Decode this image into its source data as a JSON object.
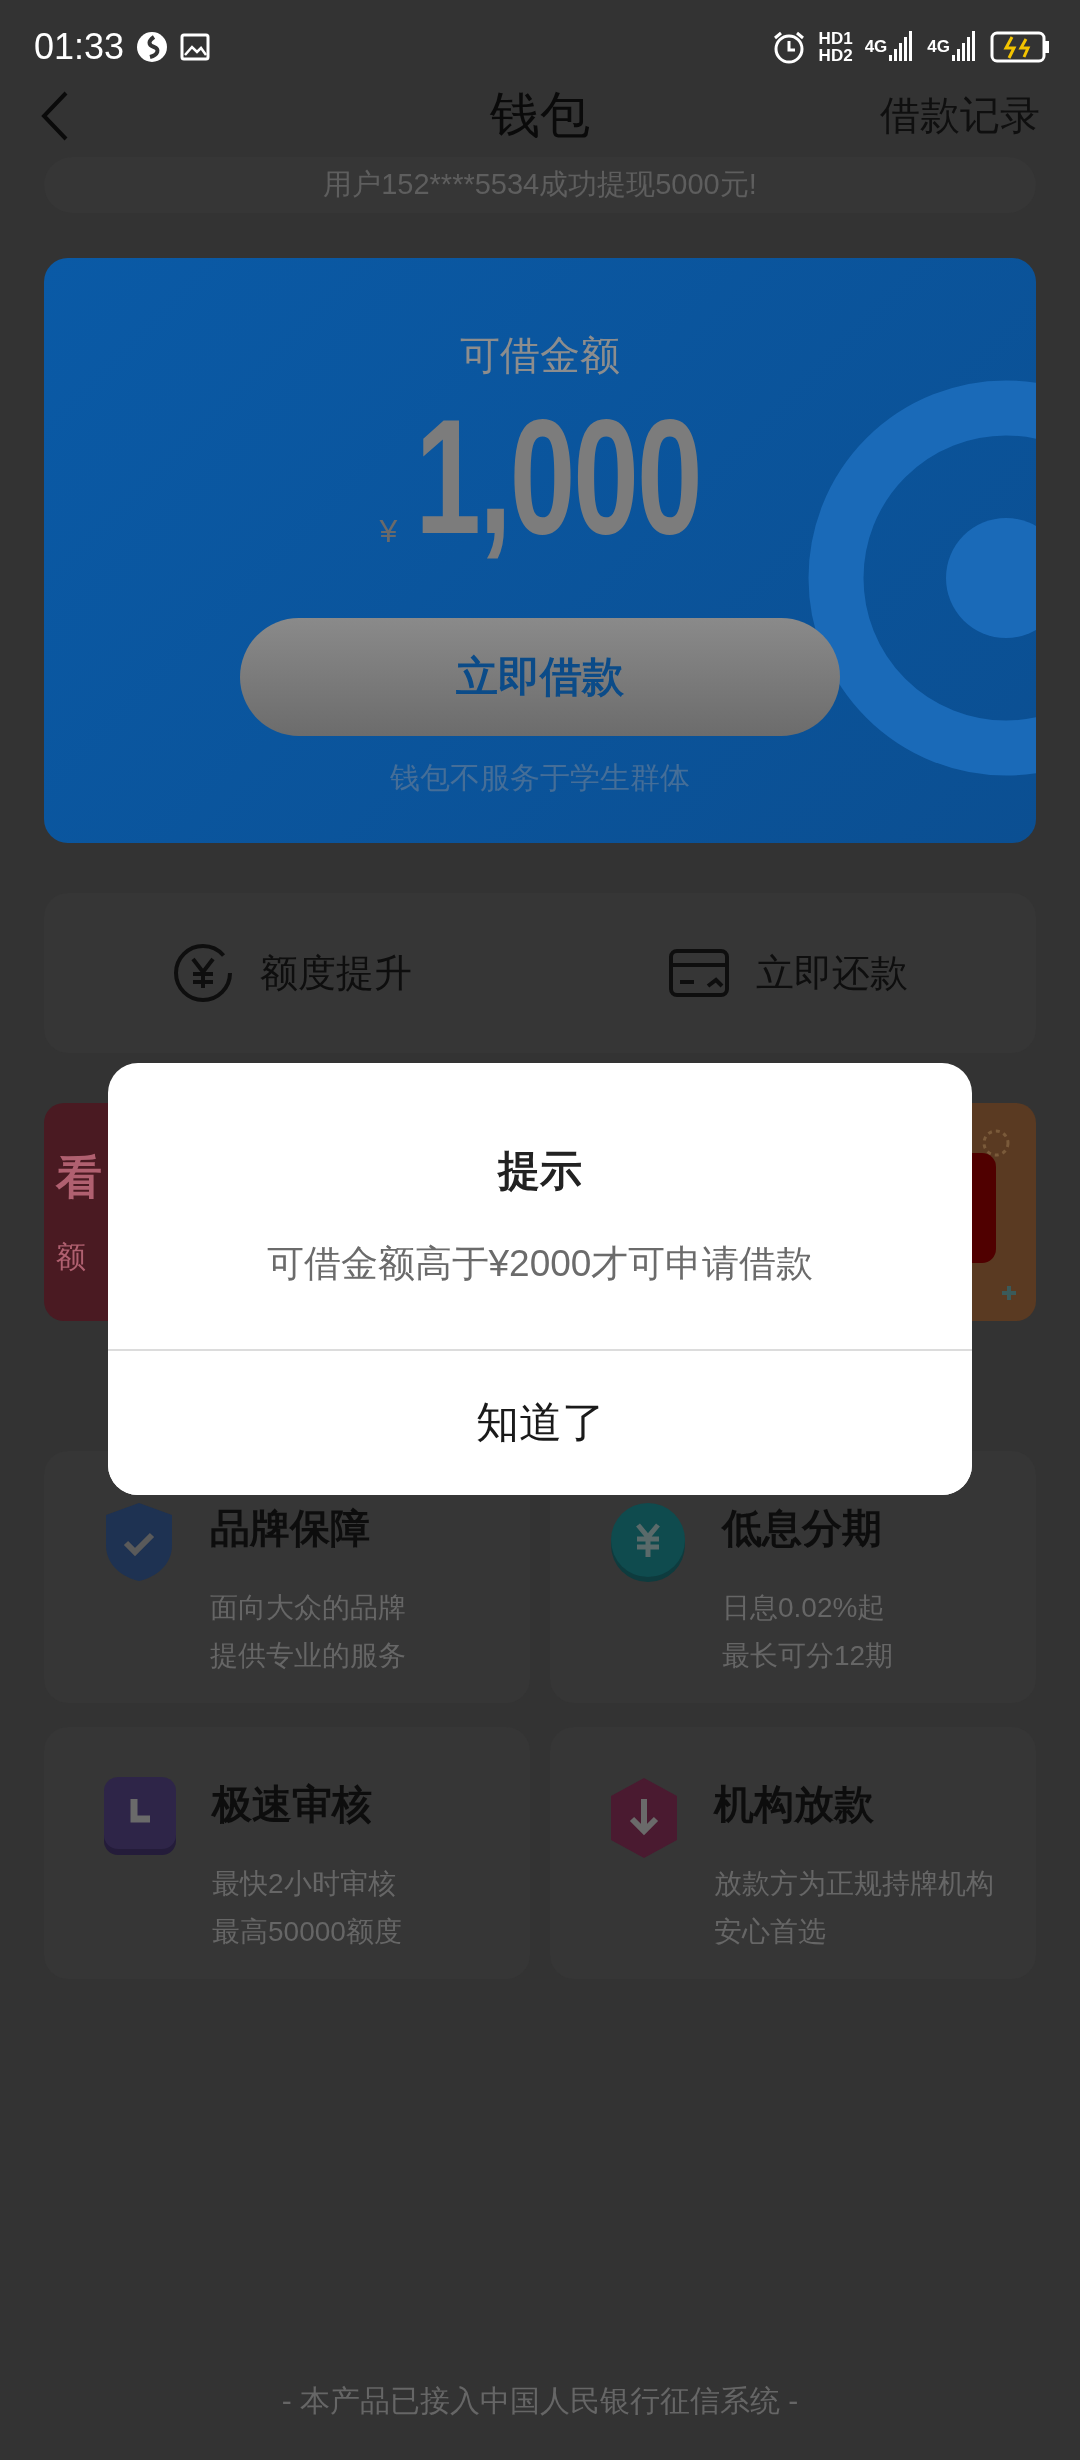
{
  "status_bar": {
    "time": "01:33",
    "sim_labels": [
      "HD1",
      "HD2"
    ],
    "network_labels": [
      "4G",
      "4G"
    ]
  },
  "nav": {
    "title": "钱包",
    "action": "借款记录"
  },
  "notice": "用户152****5534成功提现5000元!",
  "loan_card": {
    "label": "可借金额",
    "currency": "¥",
    "amount": "1,000",
    "button": "立即借款",
    "note": "钱包不服务于学生群体"
  },
  "actions": [
    {
      "kind": "yen",
      "label": "额度提升"
    },
    {
      "kind": "card",
      "label": "立即还款"
    }
  ],
  "promo_banner": {
    "title": "看",
    "subtitle": "额"
  },
  "features": [
    {
      "kind": "shield",
      "title": "品牌保障",
      "lines": [
        "面向大众的品牌",
        "提供专业的服务"
      ]
    },
    {
      "kind": "coin",
      "title": "低息分期",
      "lines": [
        "日息0.02%起",
        "最长可分12期"
      ]
    },
    {
      "kind": "clock",
      "title": "极速审核",
      "lines": [
        "最快2小时审核",
        "最高50000额度"
      ]
    },
    {
      "kind": "hexagon",
      "title": "机构放款",
      "lines": [
        "放款方为正规持牌机构",
        "安心首选"
      ]
    }
  ],
  "dialog": {
    "title": "提示",
    "message": "可借金额高于¥2000才可申请借款",
    "button": "知道了"
  },
  "footer": "- 本产品已接入中国人民银行征信系统 -"
}
